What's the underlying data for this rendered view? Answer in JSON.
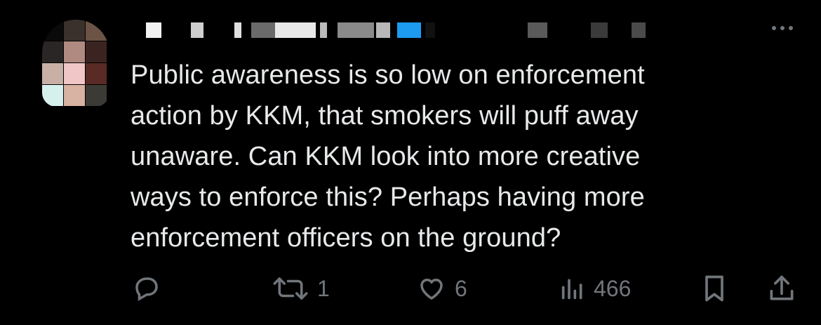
{
  "tweet": {
    "text": "Public awareness is so low on enforcement\naction by KKM, that smokers will puff away\nunaware. Can KKM look into more creative\nways to enforce this? Perhaps having more\nenforcement officers on the ground?"
  },
  "actions": {
    "reply_count": "",
    "retweet_count": "1",
    "like_count": "6",
    "views_count": "466"
  },
  "icons": [
    "avatar-pixelated",
    "more-options-icon",
    "reply-icon",
    "retweet-icon",
    "like-icon",
    "views-icon",
    "bookmark-icon",
    "share-icon"
  ],
  "colors": {
    "background": "#000000",
    "text": "#e7e9ea",
    "muted": "#71767b",
    "redaction_blue": "#1d9bf0"
  }
}
